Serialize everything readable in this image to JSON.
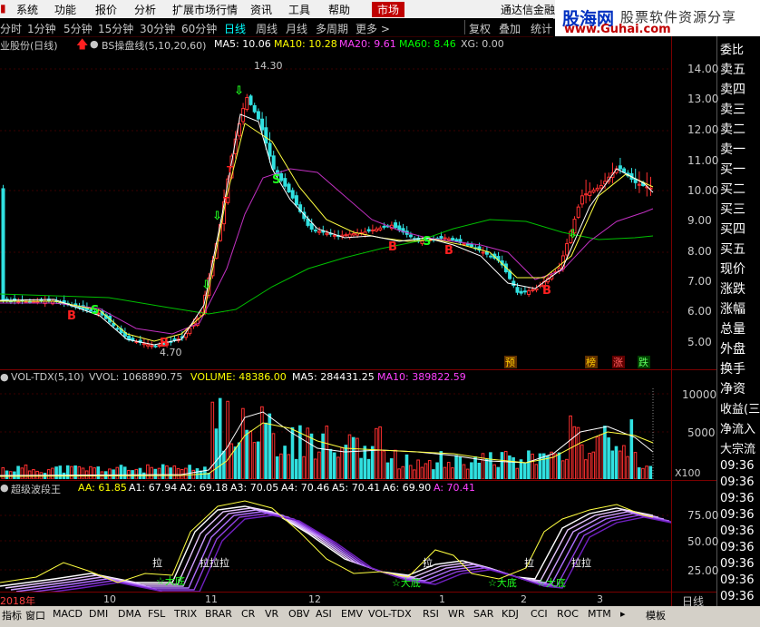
{
  "menu": {
    "items": [
      "系统",
      "功能",
      "报价",
      "分析",
      "扩展市场行情",
      "资讯",
      "工具",
      "帮助"
    ],
    "market": "市场",
    "right_title": "通达信金融终"
  },
  "toolbar": {
    "periods": [
      "分时",
      "1分钟",
      "5分钟",
      "15分钟",
      "30分钟",
      "60分钟",
      "日线",
      "周线",
      "月线",
      "多周期",
      "更多 >"
    ],
    "active_period": "日线",
    "right_buttons": [
      "复权",
      "叠加",
      "统计"
    ]
  },
  "watermark": {
    "brand": "股海网",
    "slogan": "股票软件资源分享",
    "url": "www.Guhai.com"
  },
  "main_chart": {
    "title": "业股份(日线)",
    "indicator": "BS操盘线(5,10,20,60)",
    "ma5": "MA5: 10.06",
    "ma10": "MA10: 10.28",
    "ma20": "MA20: 9.61",
    "ma60": "MA60: 8.46",
    "xg": "XG: 0.00",
    "high_label": "14.30",
    "low_label": "4.70",
    "price_ticks": [
      "14.00",
      "13.00",
      "12.00",
      "11.00",
      "10.00",
      "9.00",
      "8.00",
      "7.00",
      "6.00",
      "5.00"
    ],
    "bottom_tags": [
      "预",
      "榜",
      "涨",
      "跌"
    ]
  },
  "volume_chart": {
    "indicator": "VOL-TDX(5,10)",
    "vvol": "VVOL: 1068890.75",
    "volume": "VOLUME: 48386.00",
    "ma5": "MA5: 284431.25",
    "ma10": "MA10: 389822.59",
    "ticks": [
      "10000",
      "5000"
    ],
    "unit": "X100"
  },
  "wave_chart": {
    "indicator": "超级波段王",
    "aa": "AA: 61.85",
    "a1": "A1: 67.94",
    "a2": "A2: 69.18",
    "a3": "A3: 70.05",
    "a4": "A4: 70.46",
    "a5": "A5: 70.41",
    "a6": "A6: 69.90",
    "a": "A: 70.41",
    "ticks": [
      "75.00",
      "50.00",
      "25.00"
    ],
    "labels": [
      "拉",
      "拉拉拉",
      "拉",
      "拉",
      "拉拉",
      "☆大底",
      "☆大底",
      "☆大底",
      "☆大底"
    ]
  },
  "x_axis": {
    "labels": [
      "2018年",
      "10",
      "11",
      "12",
      "1",
      "2",
      "3"
    ],
    "period": "日线"
  },
  "side_panel": {
    "quote_items": [
      "委比",
      "卖五",
      "卖四",
      "卖三",
      "卖二",
      "卖一",
      "买一",
      "买二",
      "买三",
      "买四",
      "买五",
      "现价",
      "涨跌",
      "涨幅",
      "总量",
      "外盘",
      "换手",
      "净资",
      "收益(三",
      "净流入",
      "大宗流"
    ],
    "times": [
      "09:36",
      "09:36",
      "09:36",
      "09:36",
      "09:36",
      "09:36",
      "09:36",
      "09:36",
      "09:36",
      "09:36",
      "09:36"
    ]
  },
  "bottom_tabs": [
    "指标",
    "窗口",
    "MACD",
    "DMI",
    "DMA",
    "FSL",
    "TRIX",
    "BRAR",
    "CR",
    "VR",
    "OBV",
    "ASI",
    "EMV",
    "VOL-TDX",
    "RSI",
    "WR",
    "SAR",
    "KDJ",
    "CCI",
    "ROC",
    "MTM",
    "模板"
  ]
}
